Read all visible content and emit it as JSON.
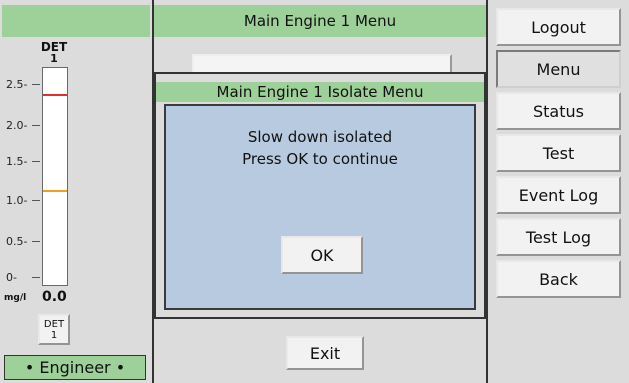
{
  "left_panel": {
    "detector_label": "DET",
    "detector_number": "1",
    "axis_ticks": [
      "2.5-",
      "2.0-",
      "1.5-",
      "1.0-",
      "0.5-",
      "0-"
    ],
    "unit": "mg/l",
    "reading": "0.0",
    "alarm_high_level": 2.2,
    "alarm_low_level": 1.1,
    "alarm_high_color": "#e03030",
    "alarm_low_color": "#f0a020",
    "detector_button": {
      "line1": "DET",
      "line2": "1"
    },
    "user_role": "• Engineer •"
  },
  "main_menu": {
    "title": "Main Engine 1 Menu",
    "exit_label": "Exit"
  },
  "dialog": {
    "title": "Main Engine 1 Isolate Menu",
    "message_line1": "Slow down isolated",
    "message_line2": "Press OK to continue",
    "ok_label": "OK"
  },
  "nav": {
    "items": [
      {
        "label": "Logout",
        "active": false
      },
      {
        "label": "Menu",
        "active": true
      },
      {
        "label": "Status",
        "active": false
      },
      {
        "label": "Test",
        "active": false
      },
      {
        "label": "Event Log",
        "active": false
      },
      {
        "label": "Test Log",
        "active": false
      },
      {
        "label": "Back",
        "active": false
      }
    ]
  }
}
